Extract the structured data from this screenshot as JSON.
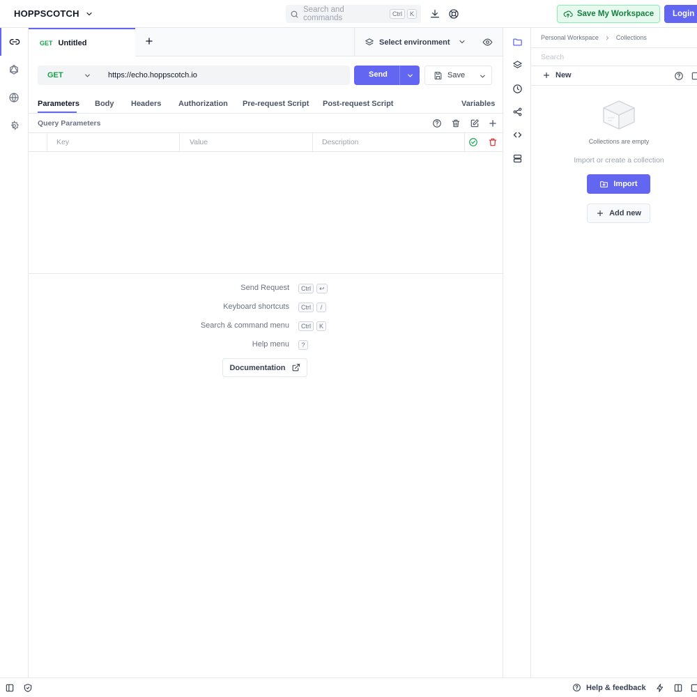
{
  "app": {
    "brand": "HOPPSCOTCH"
  },
  "topbar": {
    "search_placeholder": "Search and commands",
    "search_kbd": [
      "Ctrl",
      "K"
    ],
    "save_workspace": "Save My Workspace",
    "login": "Login"
  },
  "tabs": [
    {
      "method": "GET",
      "name": "Untitled"
    }
  ],
  "environment": {
    "label": "Select environment"
  },
  "request": {
    "method": "GET",
    "url": "https://echo.hoppscotch.io",
    "send": "Send",
    "save": "Save"
  },
  "request_tabs": [
    "Parameters",
    "Body",
    "Headers",
    "Authorization",
    "Pre-request Script",
    "Post-request Script",
    "Variables"
  ],
  "params": {
    "title": "Query Parameters",
    "key_placeholder": "Key",
    "value_placeholder": "Value",
    "description_placeholder": "Description"
  },
  "shortcuts": [
    {
      "label": "Send Request",
      "keys": [
        "Ctrl",
        "↩"
      ]
    },
    {
      "label": "Keyboard shortcuts",
      "keys": [
        "Ctrl",
        "/"
      ]
    },
    {
      "label": "Search & command menu",
      "keys": [
        "Ctrl",
        "K"
      ]
    },
    {
      "label": "Help menu",
      "keys": [
        "?"
      ]
    }
  ],
  "documentation": "Documentation",
  "collections": {
    "breadcrumb": [
      "Personal Workspace",
      "Collections"
    ],
    "search_placeholder": "Search",
    "new": "New",
    "empty_title": "Collections are empty",
    "empty_sub": "Import or create a collection",
    "import": "Import",
    "add_new": "Add new"
  },
  "footer": {
    "help_feedback": "Help & feedback"
  },
  "colors": {
    "accent": "#6366f1",
    "get_method": "#16a34a",
    "save_ws_bg": "#e6f9ef",
    "danger": "#dc2626"
  }
}
